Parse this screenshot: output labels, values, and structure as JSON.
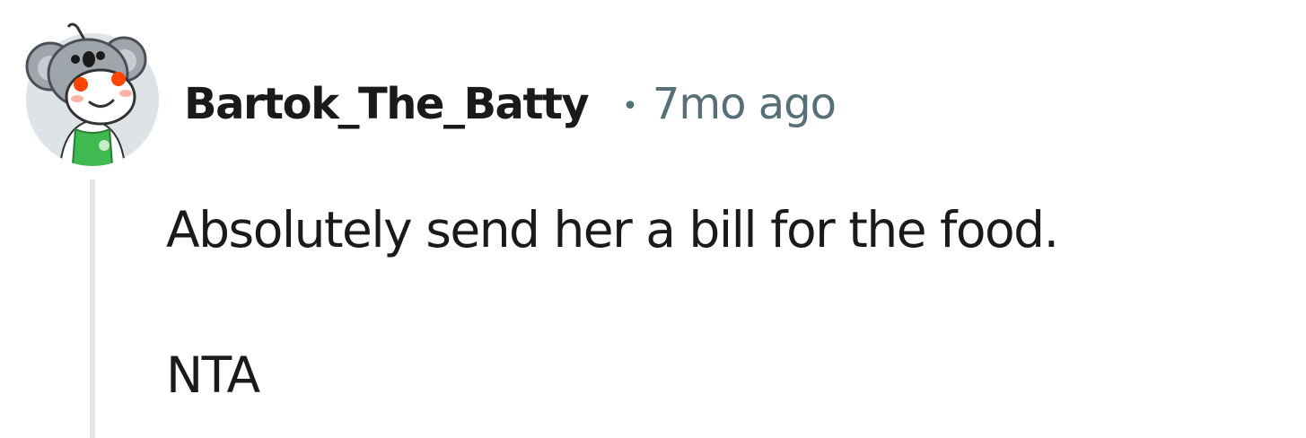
{
  "comment": {
    "author": "Bartok_The_Batty",
    "separator": "•",
    "timestamp": "7mo ago",
    "paragraphs": [
      "Absolutely send her a bill for the food.",
      "NTA"
    ]
  },
  "avatar": {
    "icon": "koala-snoo-avatar-icon",
    "colors": {
      "background": "#dde3e6",
      "koala": "#9ea6ab",
      "face": "#ffffff",
      "eyes": "#ff4500",
      "cheeks": "#ffb3a7",
      "shirt": "#3fb950"
    }
  },
  "colors": {
    "text": "#1a1a1b",
    "meta": "#576f76",
    "thread_line": "#e6e6e6"
  }
}
